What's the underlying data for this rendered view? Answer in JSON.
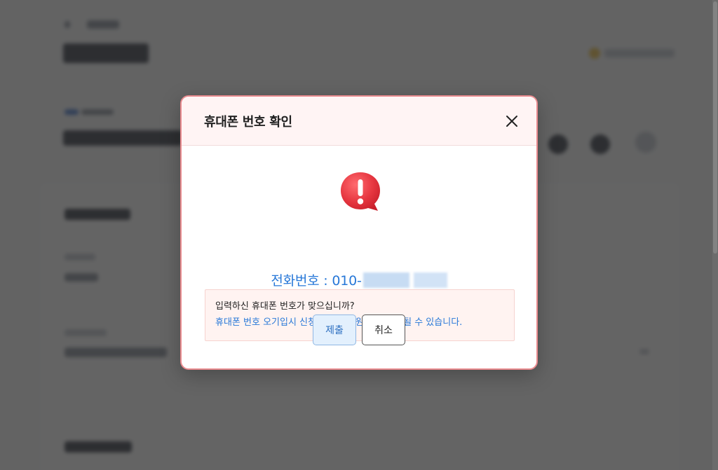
{
  "modal": {
    "title": "휴대폰 번호 확인",
    "phone_label": "전화번호 : 010-",
    "notice_line1": "입력하신 휴대폰 번호가 맞으십니까?",
    "notice_line2": "휴대폰 번호 오기입시 신청알림 및 지원에 지연이 될 수 있습니다.",
    "submit_label": "제출",
    "cancel_label": "취소",
    "close_icon": "close-icon",
    "alert_icon": "exclamation-speech-bubble-icon"
  },
  "colors": {
    "accent_blue": "#2878d8",
    "alert_red": "#e0313c",
    "modal_border": "#e98a8e",
    "notice_bg": "#fff3f1"
  }
}
